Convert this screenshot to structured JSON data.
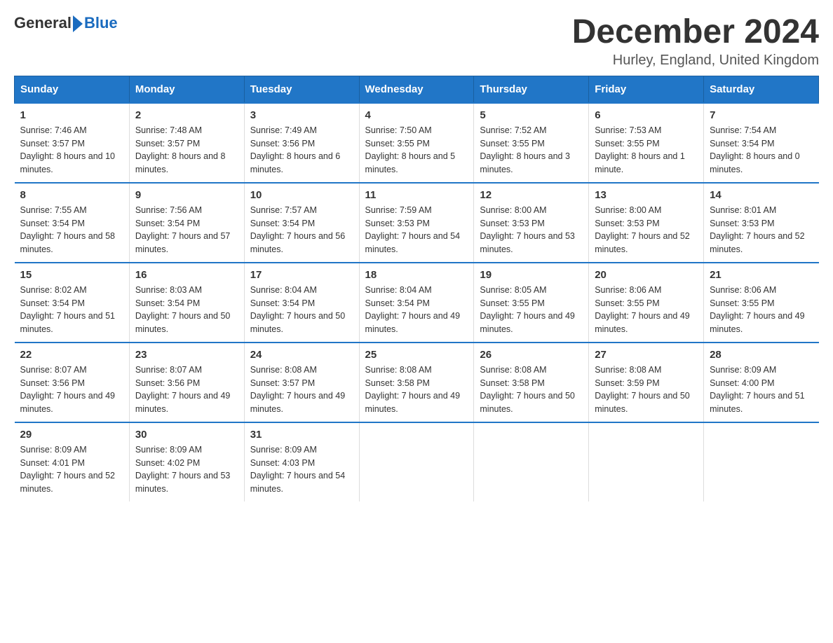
{
  "header": {
    "logo_general": "General",
    "logo_blue": "Blue",
    "month_title": "December 2024",
    "location": "Hurley, England, United Kingdom"
  },
  "days_of_week": [
    "Sunday",
    "Monday",
    "Tuesday",
    "Wednesday",
    "Thursday",
    "Friday",
    "Saturday"
  ],
  "weeks": [
    [
      {
        "day": "1",
        "sunrise": "7:46 AM",
        "sunset": "3:57 PM",
        "daylight": "8 hours and 10 minutes."
      },
      {
        "day": "2",
        "sunrise": "7:48 AM",
        "sunset": "3:57 PM",
        "daylight": "8 hours and 8 minutes."
      },
      {
        "day": "3",
        "sunrise": "7:49 AM",
        "sunset": "3:56 PM",
        "daylight": "8 hours and 6 minutes."
      },
      {
        "day": "4",
        "sunrise": "7:50 AM",
        "sunset": "3:55 PM",
        "daylight": "8 hours and 5 minutes."
      },
      {
        "day": "5",
        "sunrise": "7:52 AM",
        "sunset": "3:55 PM",
        "daylight": "8 hours and 3 minutes."
      },
      {
        "day": "6",
        "sunrise": "7:53 AM",
        "sunset": "3:55 PM",
        "daylight": "8 hours and 1 minute."
      },
      {
        "day": "7",
        "sunrise": "7:54 AM",
        "sunset": "3:54 PM",
        "daylight": "8 hours and 0 minutes."
      }
    ],
    [
      {
        "day": "8",
        "sunrise": "7:55 AM",
        "sunset": "3:54 PM",
        "daylight": "7 hours and 58 minutes."
      },
      {
        "day": "9",
        "sunrise": "7:56 AM",
        "sunset": "3:54 PM",
        "daylight": "7 hours and 57 minutes."
      },
      {
        "day": "10",
        "sunrise": "7:57 AM",
        "sunset": "3:54 PM",
        "daylight": "7 hours and 56 minutes."
      },
      {
        "day": "11",
        "sunrise": "7:59 AM",
        "sunset": "3:53 PM",
        "daylight": "7 hours and 54 minutes."
      },
      {
        "day": "12",
        "sunrise": "8:00 AM",
        "sunset": "3:53 PM",
        "daylight": "7 hours and 53 minutes."
      },
      {
        "day": "13",
        "sunrise": "8:00 AM",
        "sunset": "3:53 PM",
        "daylight": "7 hours and 52 minutes."
      },
      {
        "day": "14",
        "sunrise": "8:01 AM",
        "sunset": "3:53 PM",
        "daylight": "7 hours and 52 minutes."
      }
    ],
    [
      {
        "day": "15",
        "sunrise": "8:02 AM",
        "sunset": "3:54 PM",
        "daylight": "7 hours and 51 minutes."
      },
      {
        "day": "16",
        "sunrise": "8:03 AM",
        "sunset": "3:54 PM",
        "daylight": "7 hours and 50 minutes."
      },
      {
        "day": "17",
        "sunrise": "8:04 AM",
        "sunset": "3:54 PM",
        "daylight": "7 hours and 50 minutes."
      },
      {
        "day": "18",
        "sunrise": "8:04 AM",
        "sunset": "3:54 PM",
        "daylight": "7 hours and 49 minutes."
      },
      {
        "day": "19",
        "sunrise": "8:05 AM",
        "sunset": "3:55 PM",
        "daylight": "7 hours and 49 minutes."
      },
      {
        "day": "20",
        "sunrise": "8:06 AM",
        "sunset": "3:55 PM",
        "daylight": "7 hours and 49 minutes."
      },
      {
        "day": "21",
        "sunrise": "8:06 AM",
        "sunset": "3:55 PM",
        "daylight": "7 hours and 49 minutes."
      }
    ],
    [
      {
        "day": "22",
        "sunrise": "8:07 AM",
        "sunset": "3:56 PM",
        "daylight": "7 hours and 49 minutes."
      },
      {
        "day": "23",
        "sunrise": "8:07 AM",
        "sunset": "3:56 PM",
        "daylight": "7 hours and 49 minutes."
      },
      {
        "day": "24",
        "sunrise": "8:08 AM",
        "sunset": "3:57 PM",
        "daylight": "7 hours and 49 minutes."
      },
      {
        "day": "25",
        "sunrise": "8:08 AM",
        "sunset": "3:58 PM",
        "daylight": "7 hours and 49 minutes."
      },
      {
        "day": "26",
        "sunrise": "8:08 AM",
        "sunset": "3:58 PM",
        "daylight": "7 hours and 50 minutes."
      },
      {
        "day": "27",
        "sunrise": "8:08 AM",
        "sunset": "3:59 PM",
        "daylight": "7 hours and 50 minutes."
      },
      {
        "day": "28",
        "sunrise": "8:09 AM",
        "sunset": "4:00 PM",
        "daylight": "7 hours and 51 minutes."
      }
    ],
    [
      {
        "day": "29",
        "sunrise": "8:09 AM",
        "sunset": "4:01 PM",
        "daylight": "7 hours and 52 minutes."
      },
      {
        "day": "30",
        "sunrise": "8:09 AM",
        "sunset": "4:02 PM",
        "daylight": "7 hours and 53 minutes."
      },
      {
        "day": "31",
        "sunrise": "8:09 AM",
        "sunset": "4:03 PM",
        "daylight": "7 hours and 54 minutes."
      },
      null,
      null,
      null,
      null
    ]
  ]
}
